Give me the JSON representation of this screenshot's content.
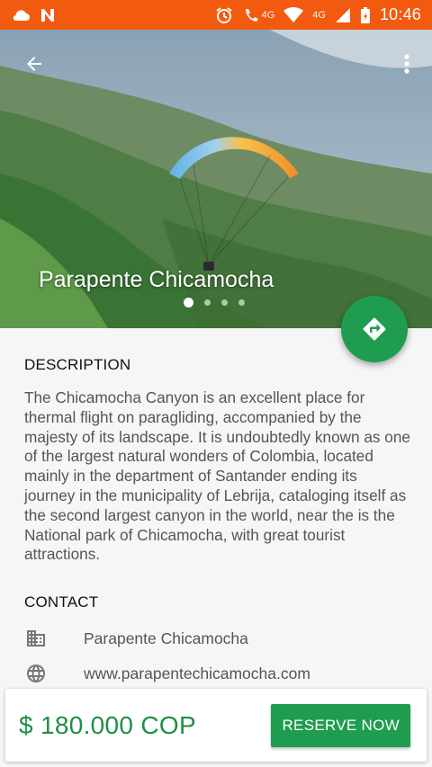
{
  "status_bar": {
    "time": "10:46",
    "network": "4G",
    "call_network": "4G"
  },
  "hero": {
    "title": "Parapente Chicamocha",
    "image_description_icon": "paraglider-photo",
    "carousel": {
      "count": 4,
      "active_index": 0
    }
  },
  "description": {
    "heading": "DESCRIPTION",
    "text": "The Chicamocha Canyon is an excellent place for thermal flight on paragliding, accompanied by the majesty of its landscape. It is undoubtedly known as one of the largest natural wonders of Colombia, located mainly in the department of Santander ending its journey in the municipality of Lebrija, cataloging itself as the second largest canyon in the world, near the is the National park of Chicamocha, with great tourist attractions."
  },
  "contact": {
    "heading": "CONTACT",
    "items": [
      {
        "icon": "building-icon",
        "text": "Parapente Chicamocha"
      },
      {
        "icon": "globe-icon",
        "text": "www.parapentechicamocha.com"
      }
    ]
  },
  "booking": {
    "price": "$ 180.000 COP",
    "reserve_label": "RESERVE NOW"
  },
  "colors": {
    "status_bar": "#f25a0f",
    "accent_green": "#1f9c4f",
    "price_green": "#1e8f44"
  }
}
